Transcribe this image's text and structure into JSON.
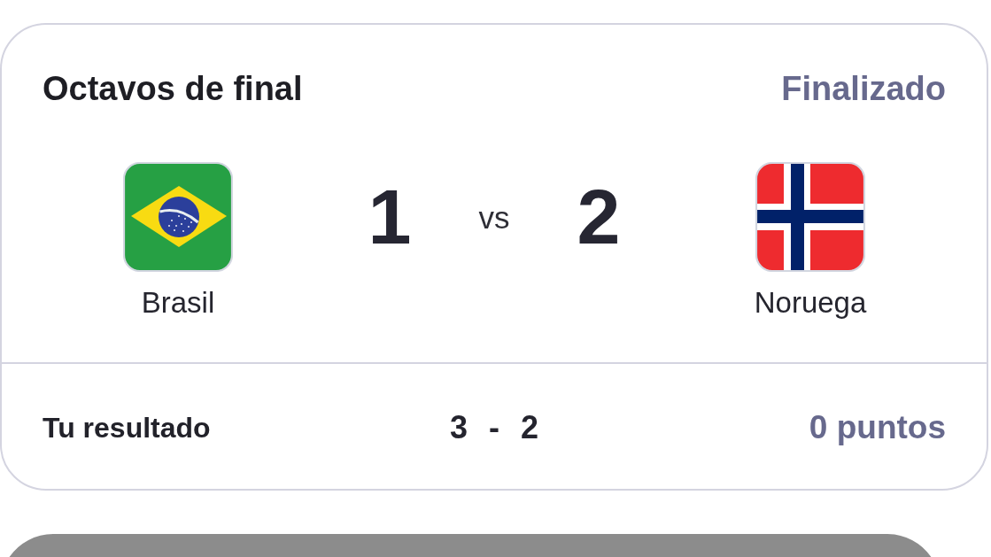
{
  "match": {
    "stage": "Octavos de final",
    "status": "Finalizado",
    "teams": [
      {
        "name": "Brasil",
        "score": "1",
        "kind": "brazil"
      },
      {
        "name": "Noruega",
        "score": "2",
        "kind": "norway"
      }
    ],
    "separator": "vs"
  },
  "prediction": {
    "label": "Tu resultado",
    "scores": [
      "3",
      "2"
    ],
    "separator": "-",
    "points": "0 puntos"
  }
}
